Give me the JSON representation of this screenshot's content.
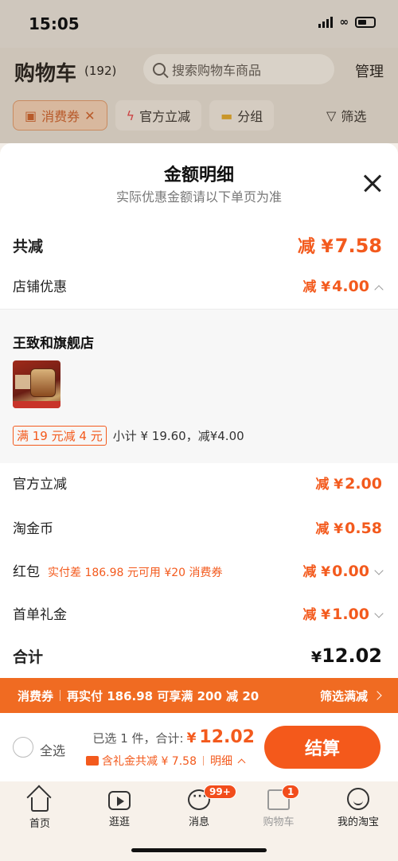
{
  "status_bar": {
    "time": "15:05"
  },
  "background": {
    "title": "购物车",
    "count": "(192)",
    "search_placeholder": "搜索购物车商品",
    "manage": "管理",
    "filters": [
      "消费券",
      "官方立减",
      "分组"
    ],
    "filter_label": "筛选"
  },
  "sheet": {
    "title": "金额明细",
    "subtitle": "实际优惠金额请以下单页为准",
    "total_discount": {
      "label": "共减",
      "prefix": "减 ¥",
      "value": "7.58"
    },
    "store_discount": {
      "label": "店铺优惠",
      "prefix": "减 ¥",
      "value": "4.00"
    },
    "store": {
      "name": "王致和旗舰店",
      "promo_tag": "满 19 元减 4 元",
      "promo_text": "小计 ¥ 19.60，减¥4.00"
    },
    "official_discount": {
      "label": "官方立减",
      "prefix": "减 ¥",
      "value": "2.00"
    },
    "taojinbi": {
      "label": "淘金币",
      "prefix": "减 ¥",
      "value": "0.58"
    },
    "hongbao": {
      "label": "红包",
      "hint": "实付差 186.98 元可用 ¥20 消费券",
      "prefix": "减 ¥",
      "value": "0.00"
    },
    "first_order": {
      "label": "首单礼金",
      "prefix": "减 ¥",
      "value": "1.00"
    },
    "total": {
      "label": "合计",
      "prefix": "¥",
      "value": "12.02"
    }
  },
  "banner": {
    "left_label": "消费券",
    "message": "再实付 186.98 可享满 200 减 20",
    "action": "筛选满减"
  },
  "checkout": {
    "select_all": "全选",
    "selected_text": "已选 1 件，合计:",
    "price_prefix": "¥",
    "price": "12.02",
    "detail_text": "含礼金共减 ¥ 7.58",
    "detail_link": "明细",
    "pay_button": "结算"
  },
  "tabbar": {
    "tabs": [
      {
        "label": "首页",
        "icon": "home-icon"
      },
      {
        "label": "逛逛",
        "icon": "play-icon"
      },
      {
        "label": "消息",
        "icon": "message-icon",
        "badge": "99+"
      },
      {
        "label": "购物车",
        "icon": "cart-icon",
        "badge": "1"
      },
      {
        "label": "我的淘宝",
        "icon": "profile-icon"
      }
    ]
  },
  "colors": {
    "accent": "#f35a1d",
    "banner": "#f06b22",
    "button": "#f4591b"
  }
}
